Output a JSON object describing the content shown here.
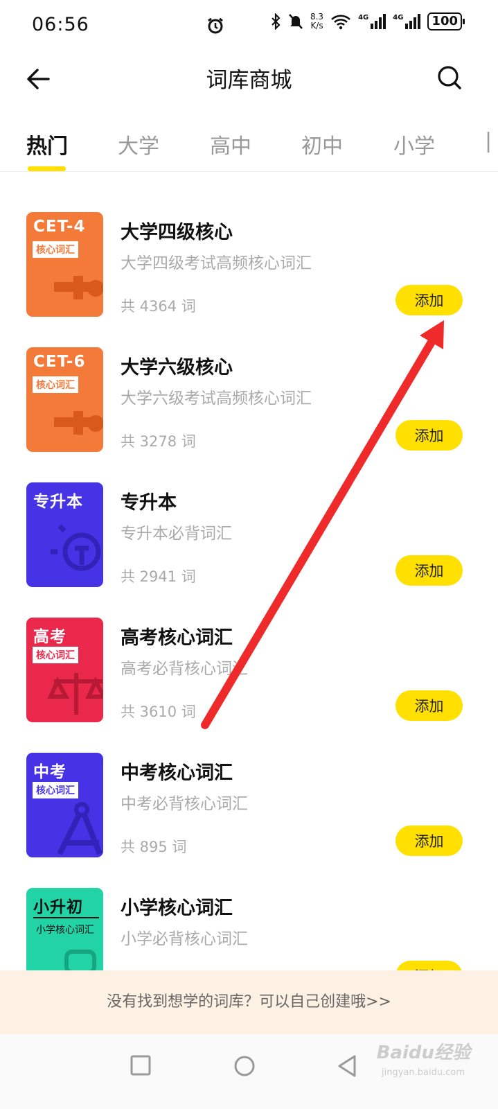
{
  "status": {
    "time": "06:56",
    "net_speed_value": "8.3",
    "net_speed_unit": "K/s",
    "sig1_label": "4G",
    "sig2_label": "4G",
    "battery": "100"
  },
  "header": {
    "title": "词库商城"
  },
  "tabs": [
    {
      "label": "热门"
    },
    {
      "label": "大学"
    },
    {
      "label": "高中"
    },
    {
      "label": "初中"
    },
    {
      "label": "小学"
    }
  ],
  "books": [
    {
      "cover_title": "CET-4",
      "cover_tag": "核心词汇",
      "cover_color": "#f47a3a",
      "name": "大学四级核心",
      "desc": "大学四级考试高频核心词汇",
      "count": "共 4364 词",
      "button": "添加"
    },
    {
      "cover_title": "CET-6",
      "cover_tag": "核心词汇",
      "cover_color": "#f47a3a",
      "name": "大学六级核心",
      "desc": "大学六级考试高频核心词汇",
      "count": "共 3278 词",
      "button": "添加"
    },
    {
      "cover_title": "专升本",
      "cover_tag": "",
      "cover_color": "#4633e6",
      "name": "专升本",
      "desc": "专升本必背词汇",
      "count": "共 2941 词",
      "button": "添加"
    },
    {
      "cover_title": "高考",
      "cover_tag": "核心词汇",
      "cover_color": "#e9284b",
      "name": "高考核心词汇",
      "desc": "高考必背核心词汇",
      "count": "共 3610 词",
      "button": "添加"
    },
    {
      "cover_title": "中考",
      "cover_tag": "核心词汇",
      "cover_color": "#4633e6",
      "name": "中考核心词汇",
      "desc": "中考必背核心词汇",
      "count": "共 895 词",
      "button": "添加"
    },
    {
      "cover_title": "小升初",
      "cover_tag": "小学核心词汇",
      "cover_color": "#22d3a6",
      "name": "小学核心词汇",
      "desc": "小学必背核心词汇",
      "count": "",
      "button": "添加"
    }
  ],
  "footer": {
    "banner_text": "没有找到想学的词库？可以自己创建哦>>"
  },
  "watermark": {
    "text": "Baidu经验",
    "sub": "jingyan.baidu.com"
  },
  "colors": {
    "accent": "#ffe000",
    "annotation_arrow": "#ee2a2a"
  }
}
